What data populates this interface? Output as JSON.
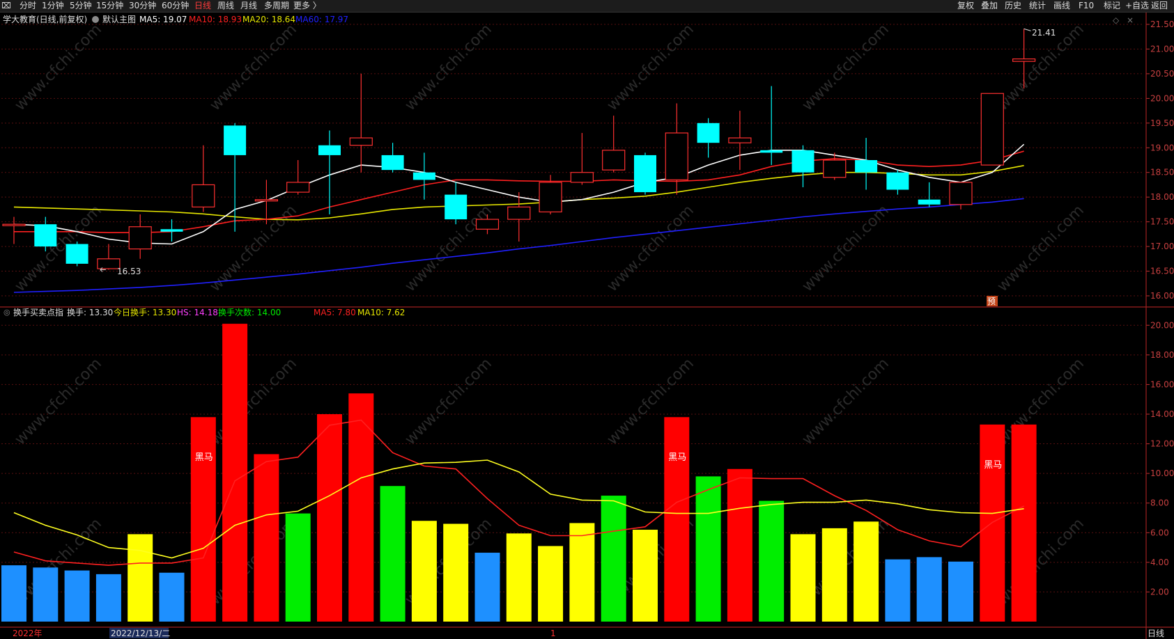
{
  "toolbar": {
    "left_icon": "collapse-icon",
    "left_items": [
      "分时",
      "1分钟",
      "5分钟",
      "15分钟",
      "30分钟",
      "60分钟",
      "日线",
      "周线",
      "月线",
      "多周期",
      "更多 〉"
    ],
    "active_item": "日线",
    "right_items": [
      "复权",
      "叠加",
      "历史",
      "统计",
      "画线",
      "F10",
      "标记",
      "+自选",
      "返回"
    ]
  },
  "main_panel": {
    "stock_title": "学大教育(日线,前复权)",
    "main_chart_label": "默认主图",
    "ma5": "MA5: 19.07",
    "ma10": "MA10: 18.93",
    "ma20": "MA20: 18.64",
    "ma60": "MA60: 17.97",
    "high_marker": "21.41",
    "low_marker": "16.53",
    "pre_tag": "预",
    "y_ticks": [
      "21.50",
      "21.00",
      "20.50",
      "20.00",
      "19.50",
      "19.00",
      "18.50",
      "18.00",
      "17.50",
      "17.00",
      "16.50",
      "16.00"
    ]
  },
  "sub_panel": {
    "indicator_name": "换手买卖点指",
    "huanshou": "换手: 13.30",
    "today_huanshou": "今日换手: 13.30",
    "hs": "HS: 14.18",
    "count": "换手次数: 14.00",
    "ma5": "MA5: 7.80",
    "ma10": "MA10: 7.62",
    "heima_label": "黑马",
    "y_ticks": [
      "20.00",
      "18.00",
      "16.00",
      "14.00",
      "12.00",
      "10.00",
      "8.00",
      "6.00",
      "4.00",
      "2.00"
    ]
  },
  "bottom_bar": {
    "year_label": "2022年",
    "date_label": "2022/12/13/二",
    "month_mark": "1",
    "period": "日线"
  },
  "watermark": "www.cfchi.com",
  "colors": {
    "up": "#ff3030",
    "down": "#00ffff",
    "ma5_line": "#ffffff",
    "ma10_line": "#ff2020",
    "ma20_line": "#e8e800",
    "ma60_line": "#2020ff",
    "bar_red": "#ff0000",
    "bar_yellow": "#ffff00",
    "bar_green": "#00ee00",
    "bar_blue": "#1e90ff"
  },
  "chart_data": [
    {
      "type": "candlestick",
      "title": "学大教育(日线,前复权)",
      "ylim": [
        15.9,
        21.7
      ],
      "candles": [
        {
          "o": 17.45,
          "c": 17.45,
          "h": 17.6,
          "l": 17.05
        },
        {
          "o": 17.45,
          "c": 17.0,
          "h": 17.6,
          "l": 16.9
        },
        {
          "o": 17.05,
          "c": 16.65,
          "h": 17.1,
          "l": 16.6
        },
        {
          "o": 16.55,
          "c": 16.75,
          "h": 17.05,
          "l": 16.53
        },
        {
          "o": 16.95,
          "c": 17.4,
          "h": 17.65,
          "l": 16.75
        },
        {
          "o": 17.35,
          "c": 17.3,
          "h": 17.55,
          "l": 17.1
        },
        {
          "o": 17.8,
          "c": 18.25,
          "h": 19.05,
          "l": 17.7
        },
        {
          "o": 19.45,
          "c": 18.85,
          "h": 19.5,
          "l": 17.3
        },
        {
          "o": 17.95,
          "c": 17.95,
          "h": 18.35,
          "l": 17.45
        },
        {
          "o": 18.1,
          "c": 18.3,
          "h": 18.75,
          "l": 18.05
        },
        {
          "o": 19.05,
          "c": 18.85,
          "h": 19.35,
          "l": 17.65
        },
        {
          "o": 19.05,
          "c": 19.2,
          "h": 20.5,
          "l": 18.5
        },
        {
          "o": 18.85,
          "c": 18.55,
          "h": 19.1,
          "l": 18.5
        },
        {
          "o": 18.5,
          "c": 18.35,
          "h": 18.9,
          "l": 17.95
        },
        {
          "o": 18.05,
          "c": 17.55,
          "h": 18.3,
          "l": 17.45
        },
        {
          "o": 17.35,
          "c": 17.55,
          "h": 17.65,
          "l": 17.25
        },
        {
          "o": 17.55,
          "c": 17.8,
          "h": 18.1,
          "l": 17.1
        },
        {
          "o": 17.7,
          "c": 18.3,
          "h": 18.45,
          "l": 17.65
        },
        {
          "o": 18.3,
          "c": 18.5,
          "h": 19.3,
          "l": 18.25
        },
        {
          "o": 18.55,
          "c": 18.95,
          "h": 19.65,
          "l": 18.5
        },
        {
          "o": 18.85,
          "c": 18.1,
          "h": 18.9,
          "l": 18.05
        },
        {
          "o": 18.35,
          "c": 19.3,
          "h": 19.9,
          "l": 18.05
        },
        {
          "o": 19.5,
          "c": 19.1,
          "h": 19.6,
          "l": 18.8
        },
        {
          "o": 19.1,
          "c": 19.2,
          "h": 19.75,
          "l": 18.55
        },
        {
          "o": 18.95,
          "c": 18.9,
          "h": 20.25,
          "l": 18.65
        },
        {
          "o": 18.95,
          "c": 18.5,
          "h": 19.05,
          "l": 18.2
        },
        {
          "o": 18.4,
          "c": 18.75,
          "h": 18.9,
          "l": 18.35
        },
        {
          "o": 18.75,
          "c": 18.5,
          "h": 19.2,
          "l": 18.15
        },
        {
          "o": 18.5,
          "c": 18.15,
          "h": 18.55,
          "l": 18.05
        },
        {
          "o": 17.95,
          "c": 17.85,
          "h": 18.3,
          "l": 17.8
        },
        {
          "o": 17.85,
          "c": 18.3,
          "h": 18.3,
          "l": 17.75
        },
        {
          "o": 18.65,
          "c": 20.1,
          "h": 20.1,
          "l": 18.65
        },
        {
          "o": 20.75,
          "c": 20.8,
          "h": 21.41,
          "l": 20.2
        }
      ],
      "ma5": [
        17.45,
        17.42,
        17.3,
        17.15,
        17.07,
        17.05,
        17.3,
        17.75,
        17.93,
        18.2,
        18.45,
        18.65,
        18.6,
        18.5,
        18.3,
        18.15,
        18.0,
        17.9,
        17.95,
        18.1,
        18.3,
        18.4,
        18.65,
        18.85,
        18.95,
        18.95,
        18.85,
        18.75,
        18.55,
        18.4,
        18.3,
        18.5,
        19.07
      ],
      "ma10": [
        17.3,
        17.3,
        17.3,
        17.28,
        17.28,
        17.3,
        17.4,
        17.52,
        17.55,
        17.62,
        17.8,
        17.95,
        18.1,
        18.25,
        18.35,
        18.35,
        18.33,
        18.32,
        18.32,
        18.35,
        18.33,
        18.32,
        18.35,
        18.45,
        18.62,
        18.73,
        18.78,
        18.75,
        18.65,
        18.62,
        18.65,
        18.75,
        18.93
      ],
      "ma20": [
        17.8,
        17.78,
        17.76,
        17.74,
        17.72,
        17.7,
        17.66,
        17.6,
        17.55,
        17.54,
        17.58,
        17.66,
        17.75,
        17.8,
        17.82,
        17.84,
        17.86,
        17.9,
        17.95,
        17.98,
        18.02,
        18.1,
        18.2,
        18.3,
        18.38,
        18.45,
        18.5,
        18.5,
        18.48,
        18.45,
        18.45,
        18.52,
        18.64
      ],
      "ma60": [
        16.07,
        16.09,
        16.11,
        16.14,
        16.17,
        16.21,
        16.26,
        16.32,
        16.38,
        16.44,
        16.51,
        16.58,
        16.66,
        16.73,
        16.8,
        16.87,
        16.95,
        17.02,
        17.1,
        17.18,
        17.25,
        17.32,
        17.39,
        17.46,
        17.53,
        17.6,
        17.66,
        17.71,
        17.76,
        17.8,
        17.85,
        17.9,
        17.97
      ]
    },
    {
      "type": "bar",
      "title": "换手买卖点指",
      "ylim": [
        0,
        20.2
      ],
      "values": [
        3.8,
        3.65,
        3.45,
        3.2,
        5.9,
        3.3,
        13.8,
        20.1,
        11.3,
        7.3,
        14.0,
        15.4,
        9.15,
        6.8,
        6.6,
        4.65,
        5.95,
        5.1,
        6.65,
        8.5,
        6.2,
        13.8,
        9.8,
        10.3,
        8.15,
        5.9,
        6.3,
        6.75,
        4.2,
        4.35,
        4.05,
        13.3,
        13.3
      ],
      "colors": [
        "blue",
        "blue",
        "blue",
        "blue",
        "yellow",
        "blue",
        "red",
        "red",
        "red",
        "green",
        "red",
        "red",
        "green",
        "yellow",
        "yellow",
        "blue",
        "yellow",
        "yellow",
        "yellow",
        "green",
        "yellow",
        "red",
        "green",
        "red",
        "green",
        "yellow",
        "yellow",
        "yellow",
        "blue",
        "blue",
        "blue",
        "red",
        "red"
      ],
      "heima_index": [
        6,
        21,
        31
      ],
      "ma5": [
        4.7,
        4.1,
        3.95,
        3.8,
        3.95,
        3.95,
        4.3,
        9.5,
        10.8,
        11.1,
        13.25,
        13.6,
        11.4,
        10.5,
        10.3,
        8.3,
        6.5,
        5.8,
        5.8,
        6.1,
        6.4,
        8.05,
        8.9,
        9.7,
        9.65,
        9.65,
        8.5,
        7.5,
        6.2,
        5.45,
        5.05,
        6.7,
        7.8
      ],
      "ma10": [
        7.35,
        6.5,
        5.85,
        5.0,
        4.8,
        4.3,
        4.95,
        6.5,
        7.2,
        7.45,
        8.5,
        9.7,
        10.3,
        10.7,
        10.75,
        10.9,
        10.1,
        8.6,
        8.2,
        8.15,
        7.4,
        7.3,
        7.3,
        7.65,
        7.9,
        8.05,
        8.05,
        8.2,
        7.95,
        7.55,
        7.35,
        7.3,
        7.62
      ]
    }
  ]
}
